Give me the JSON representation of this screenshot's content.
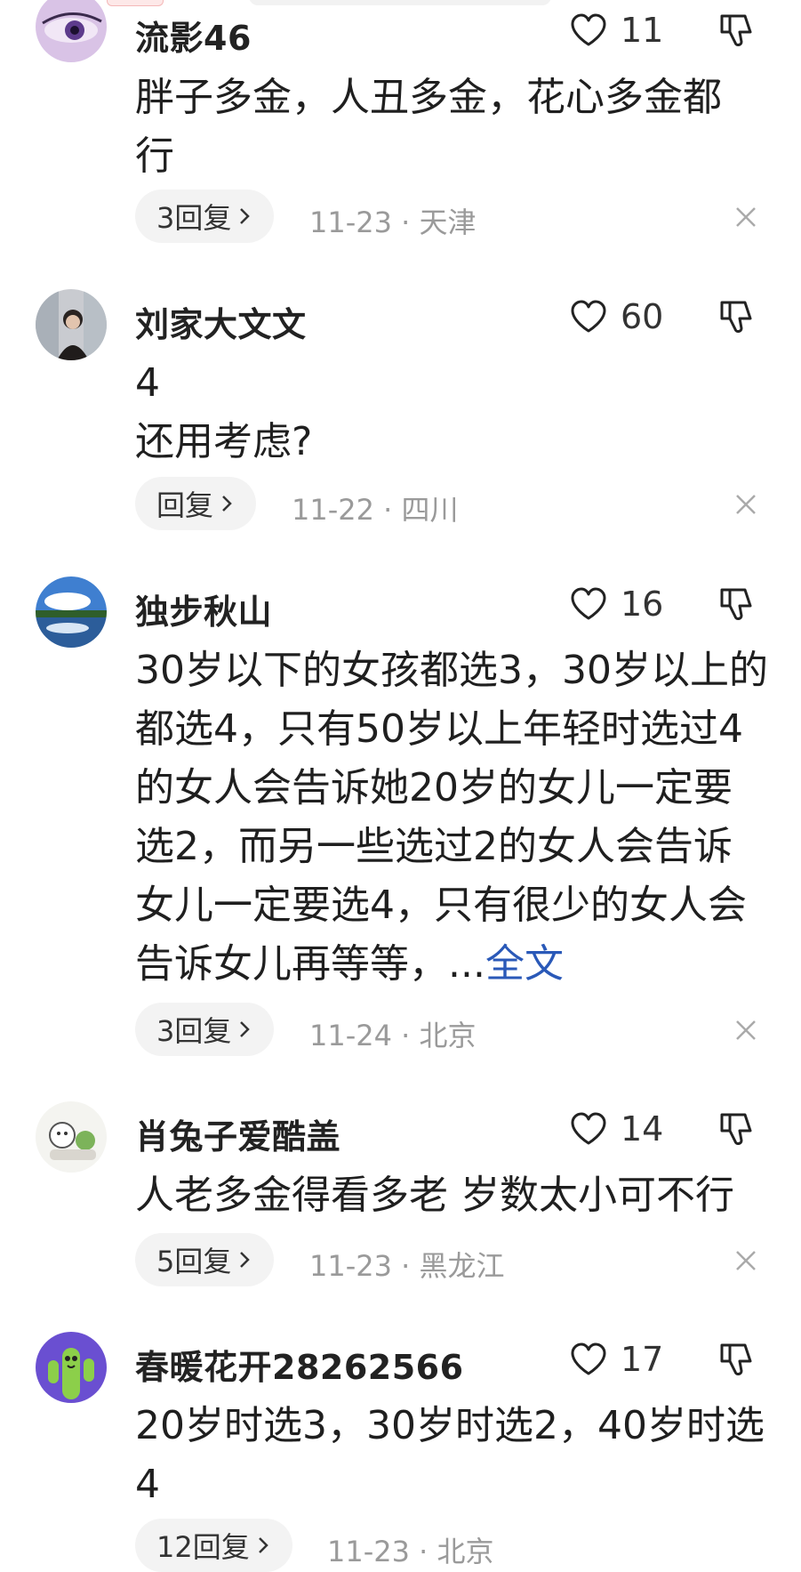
{
  "comments": [
    {
      "username": "流影46",
      "likes": "11",
      "content_lines": [
        "胖子多金，人丑多金，花心多金都",
        "行"
      ],
      "reply_label": "3回复",
      "date": "11-23",
      "location": "天津"
    },
    {
      "username": "刘家大文文",
      "likes": "60",
      "content_lines": [
        "4",
        "还用考虑?"
      ],
      "reply_label": "回复",
      "date": "11-22",
      "location": "四川"
    },
    {
      "username": "独步秋山",
      "likes": "16",
      "content_lines": [
        "30岁以下的女孩都选3，30岁以上的",
        "都选4，只有50岁以上年轻时选过4",
        "的女人会告诉她20岁的女儿一定要",
        "选2，而另一些选过2的女人会告诉",
        "女儿一定要选4，只有很少的女人会",
        "告诉女儿再等等，"
      ],
      "ellipsis": "...",
      "fulltext_link": "全文",
      "reply_label": "3回复",
      "date": "11-24",
      "location": "北京"
    },
    {
      "username": "肖兔子爱酷盖",
      "likes": "14",
      "content_lines": [
        "人老多金得看多老 岁数太小可不行"
      ],
      "reply_label": "5回复",
      "date": "11-23",
      "location": "黑龙江"
    },
    {
      "username": "春暖花开28262566",
      "likes": "17",
      "content_lines": [
        "20岁时选3，30岁时选2，40岁时选",
        "4"
      ],
      "reply_label": "12回复",
      "date": "11-23",
      "location": "北京"
    }
  ],
  "meta_separator": "·",
  "icons": {
    "like": "heart-outline-icon",
    "dislike": "thumbs-down-icon",
    "close": "close-icon",
    "chevron": "chevron-right-icon"
  },
  "colors": {
    "link": "#2a59b8",
    "meta": "#9a9a9a",
    "pill_bg": "#f3f3f3"
  }
}
